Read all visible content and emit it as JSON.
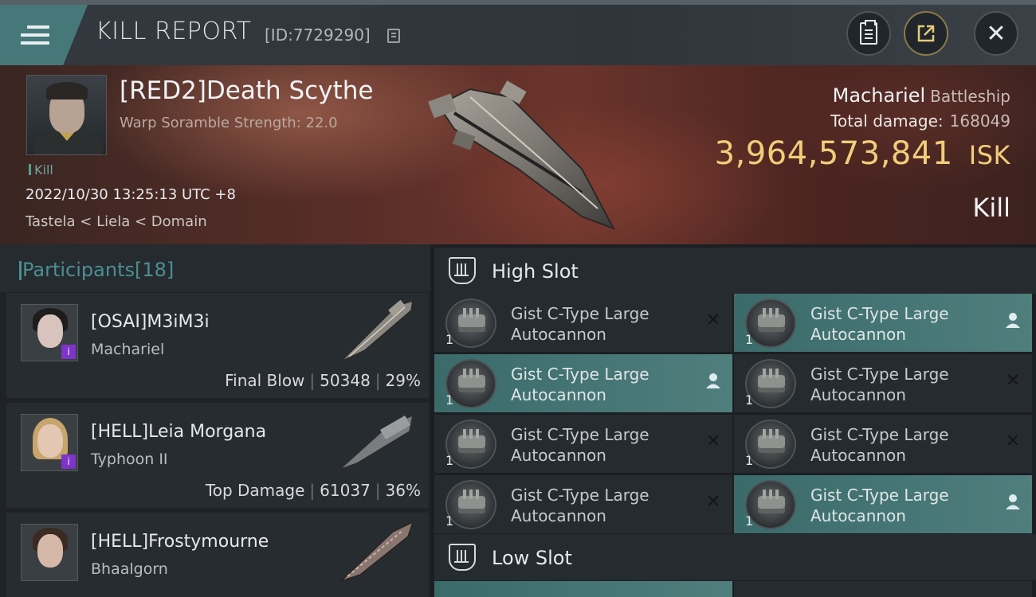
{
  "header": {
    "title": "KILL REPORT",
    "report_id": "[ID:7729290]"
  },
  "victim": {
    "name": "[RED2]Death Scythe",
    "scram": "Warp Soramble Strength: 22.0",
    "kill_tag": "Kill",
    "datetime": "2022/10/30 13:25:13 UTC +8",
    "location": "Tastela < Liela < Domain",
    "ship_name": "Machariel",
    "ship_class": "Battleship",
    "total_damage_label": "Total damage:",
    "total_damage": "168049",
    "isk_value": "3,964,573,841",
    "isk_unit": "ISK",
    "result": "Kill"
  },
  "participants": {
    "title": "Participants",
    "count": "[18]",
    "list": [
      {
        "name": "[OSAI]M3iM3i",
        "ship": "Machariel",
        "role": "Final Blow",
        "damage": "50348",
        "percent": "29%"
      },
      {
        "name": "[HELL]Leia Morgana",
        "ship": "Typhoon II",
        "role": "Top Damage",
        "damage": "61037",
        "percent": "36%"
      },
      {
        "name": "[HELL]Frostymourne",
        "ship": "Bhaalgorn",
        "role": "",
        "damage": "",
        "percent": ""
      }
    ]
  },
  "slots": {
    "high_title": "High Slot",
    "low_title": "Low Slot",
    "high_modules": [
      {
        "name": "Gist C-Type Large Autocannon",
        "qty": "1",
        "status": "destroyed"
      },
      {
        "name": "Gist C-Type Large Autocannon",
        "qty": "1",
        "status": "dropped"
      },
      {
        "name": "Gist C-Type Large Autocannon",
        "qty": "1",
        "status": "dropped"
      },
      {
        "name": "Gist C-Type Large Autocannon",
        "qty": "1",
        "status": "destroyed"
      },
      {
        "name": "Gist C-Type Large Autocannon",
        "qty": "1",
        "status": "destroyed"
      },
      {
        "name": "Gist C-Type Large Autocannon",
        "qty": "1",
        "status": "destroyed"
      },
      {
        "name": "Gist C-Type Large Autocannon",
        "qty": "1",
        "status": "destroyed"
      },
      {
        "name": "Gist C-Type Large Autocannon",
        "qty": "1",
        "status": "dropped"
      }
    ]
  },
  "icons": {
    "destroyed": "✕",
    "dropped": "person-icon"
  }
}
